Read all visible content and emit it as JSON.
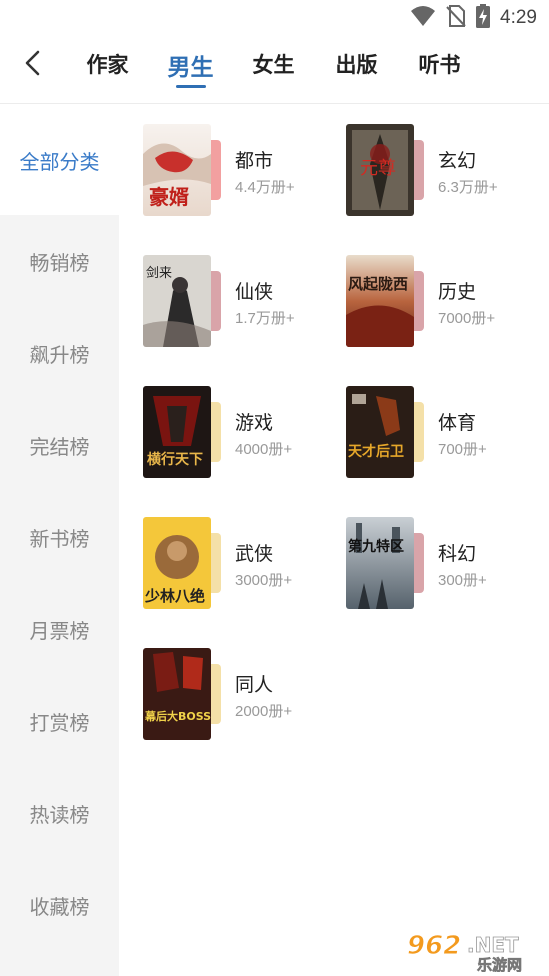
{
  "status_bar": {
    "time": "4:29",
    "icons": [
      "wifi-icon",
      "no-sim-icon",
      "battery-charging-icon"
    ]
  },
  "nav": {
    "back_icon": "chevron-left-icon",
    "tabs": [
      {
        "label": "作家",
        "active": false
      },
      {
        "label": "男生",
        "active": true
      },
      {
        "label": "女生",
        "active": false
      },
      {
        "label": "出版",
        "active": false
      },
      {
        "label": "听书",
        "active": false
      }
    ],
    "accent_color": "#2f6fb4"
  },
  "sidebar": {
    "items": [
      {
        "label": "全部分类",
        "active": true
      },
      {
        "label": "畅销榜",
        "active": false
      },
      {
        "label": "飙升榜",
        "active": false
      },
      {
        "label": "完结榜",
        "active": false
      },
      {
        "label": "新书榜",
        "active": false
      },
      {
        "label": "月票榜",
        "active": false
      },
      {
        "label": "打赏榜",
        "active": false
      },
      {
        "label": "热读榜",
        "active": false
      },
      {
        "label": "收藏榜",
        "active": false
      }
    ],
    "active_color": "#3a7bc8"
  },
  "categories": [
    {
      "name": "都市",
      "count": "4.4万册+",
      "cover_text": "豪婿",
      "accent": "#f2a0a0"
    },
    {
      "name": "玄幻",
      "count": "6.3万册+",
      "cover_text": "元尊",
      "accent": "#d9a4a9"
    },
    {
      "name": "仙侠",
      "count": "1.7万册+",
      "cover_text": "剑来",
      "accent": "#d9a4a9"
    },
    {
      "name": "历史",
      "count": "7000册+",
      "cover_text": "风起陇西",
      "accent": "#d9a4a9"
    },
    {
      "name": "游戏",
      "count": "4000册+",
      "cover_text": "横行天下",
      "accent": "#f4e0a8"
    },
    {
      "name": "体育",
      "count": "700册+",
      "cover_text": "天才后卫",
      "accent": "#f4e0a8"
    },
    {
      "name": "武侠",
      "count": "3000册+",
      "cover_text": "少林八绝",
      "accent": "#f4e0a8"
    },
    {
      "name": "科幻",
      "count": "300册+",
      "cover_text": "第九特区",
      "accent": "#d9a4a9"
    },
    {
      "name": "同人",
      "count": "2000册+",
      "cover_text": "幕后大BOSS系统",
      "accent": "#f4e0a8"
    }
  ],
  "watermark": {
    "brand_number": "962",
    "brand_suffix": ".NET",
    "brand_site": "乐游网"
  }
}
